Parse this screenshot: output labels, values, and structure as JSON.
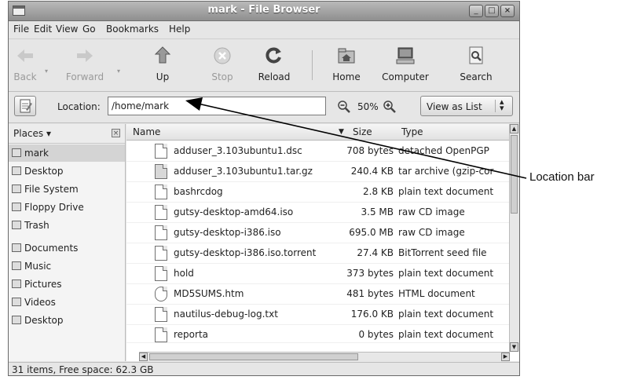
{
  "window": {
    "title": "mark - File Browser"
  },
  "menu": [
    "File",
    "Edit",
    "View",
    "Go",
    "Bookmarks",
    "Help"
  ],
  "toolbar": {
    "back": "Back",
    "forward": "Forward",
    "up": "Up",
    "stop": "Stop",
    "reload": "Reload",
    "home": "Home",
    "computer": "Computer",
    "search": "Search"
  },
  "location": {
    "label": "Location:",
    "value": "/home/mark",
    "zoom": "50%",
    "view": "View as List"
  },
  "sidebar": {
    "header": "Places ▾",
    "items": [
      {
        "label": "mark",
        "icon": "home-folder-icon"
      },
      {
        "label": "Desktop",
        "icon": "desktop-icon"
      },
      {
        "label": "File System",
        "icon": "drive-icon"
      },
      {
        "label": "Floppy Drive",
        "icon": "floppy-icon"
      },
      {
        "label": "Trash",
        "icon": "trash-icon"
      },
      {
        "label": "Documents",
        "icon": "folder-icon"
      },
      {
        "label": "Music",
        "icon": "folder-icon"
      },
      {
        "label": "Pictures",
        "icon": "folder-icon"
      },
      {
        "label": "Videos",
        "icon": "folder-icon"
      },
      {
        "label": "Desktop",
        "icon": "folder-icon"
      }
    ]
  },
  "columns": {
    "name": "Name",
    "size": "Size",
    "type": "Type"
  },
  "files": [
    {
      "name": "adduser_3.103ubuntu1.dsc",
      "size": "708 bytes",
      "type": "detached OpenPGP"
    },
    {
      "name": "adduser_3.103ubuntu1.tar.gz",
      "size": "240.4 KB",
      "type": "tar archive (gzip-cor"
    },
    {
      "name": "bashrcdog",
      "size": "2.8 KB",
      "type": "plain text document"
    },
    {
      "name": "gutsy-desktop-amd64.iso",
      "size": "3.5 MB",
      "type": "raw CD image"
    },
    {
      "name": "gutsy-desktop-i386.iso",
      "size": "695.0 MB",
      "type": "raw CD image"
    },
    {
      "name": "gutsy-desktop-i386.iso.torrent",
      "size": "27.4 KB",
      "type": "BitTorrent seed file"
    },
    {
      "name": "hold",
      "size": "373 bytes",
      "type": "plain text document"
    },
    {
      "name": "MD5SUMS.htm",
      "size": "481 bytes",
      "type": "HTML document"
    },
    {
      "name": "nautilus-debug-log.txt",
      "size": "176.0 KB",
      "type": "plain text document"
    },
    {
      "name": "reporta",
      "size": "0 bytes",
      "type": "plain text document"
    }
  ],
  "status": "31 items, Free space: 62.3 GB",
  "annotation": "Location bar"
}
